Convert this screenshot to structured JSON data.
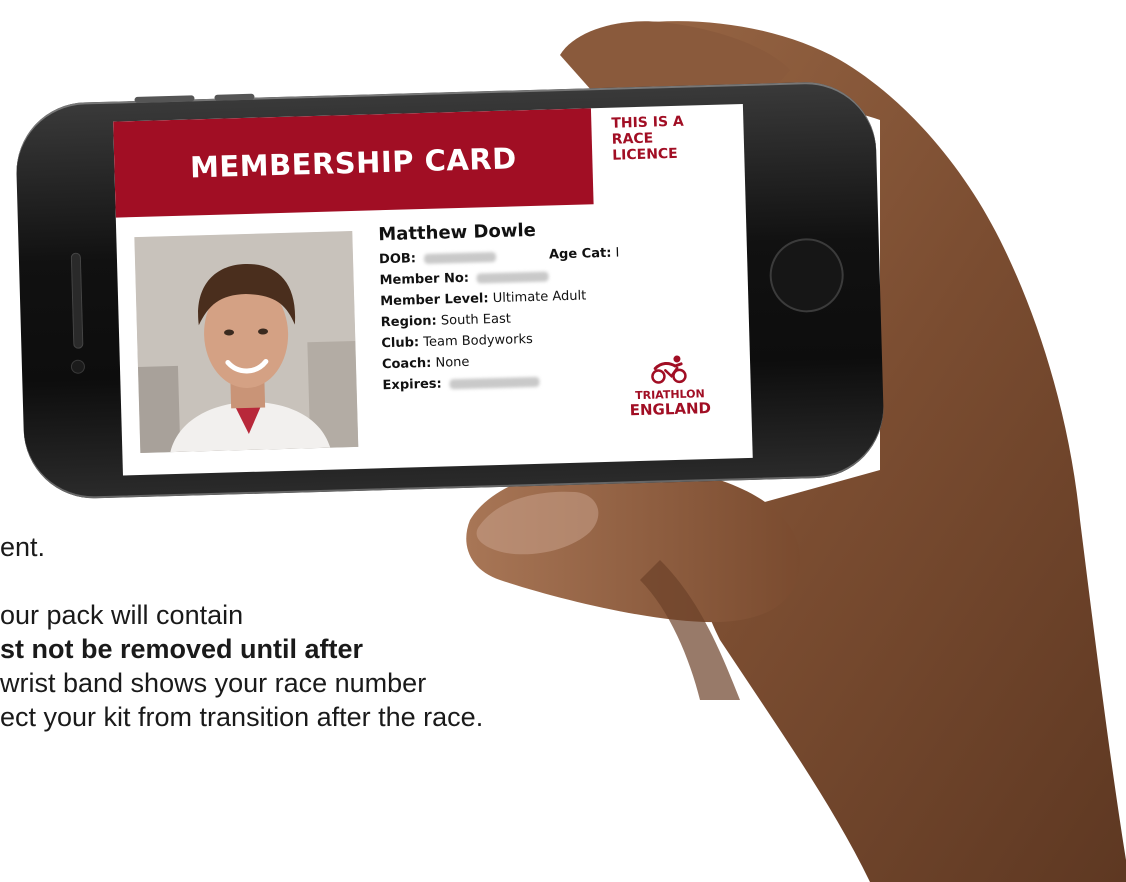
{
  "background_text": {
    "line1": "ent.",
    "line2": "our pack will contain",
    "line3": "st not be removed until after",
    "line4": " wrist band shows your race number",
    "line5": "ect your kit from transition after the race."
  },
  "card": {
    "title": "MEMBERSHIP CARD",
    "licence_lines": [
      "THIS IS A",
      "RACE",
      "LICENCE"
    ],
    "name": "Matthew Dowle",
    "fields": {
      "dob_label": "DOB:",
      "age_cat_label": "Age Cat:",
      "age_cat_value": "I",
      "member_no_label": "Member No:",
      "member_level_label": "Member Level:",
      "member_level_value": "Ultimate Adult",
      "region_label": "Region:",
      "region_value": "South East",
      "club_label": "Club:",
      "club_value": "Team Bodyworks",
      "coach_label": "Coach:",
      "coach_value": "None",
      "expires_label": "Expires:"
    },
    "logo": {
      "line1": "TRIATHLON",
      "line2": "ENGLAND",
      "icon": "triathlete-icon"
    }
  },
  "colors": {
    "brand_red": "#a10e24",
    "skin": "#8a5a3c"
  }
}
